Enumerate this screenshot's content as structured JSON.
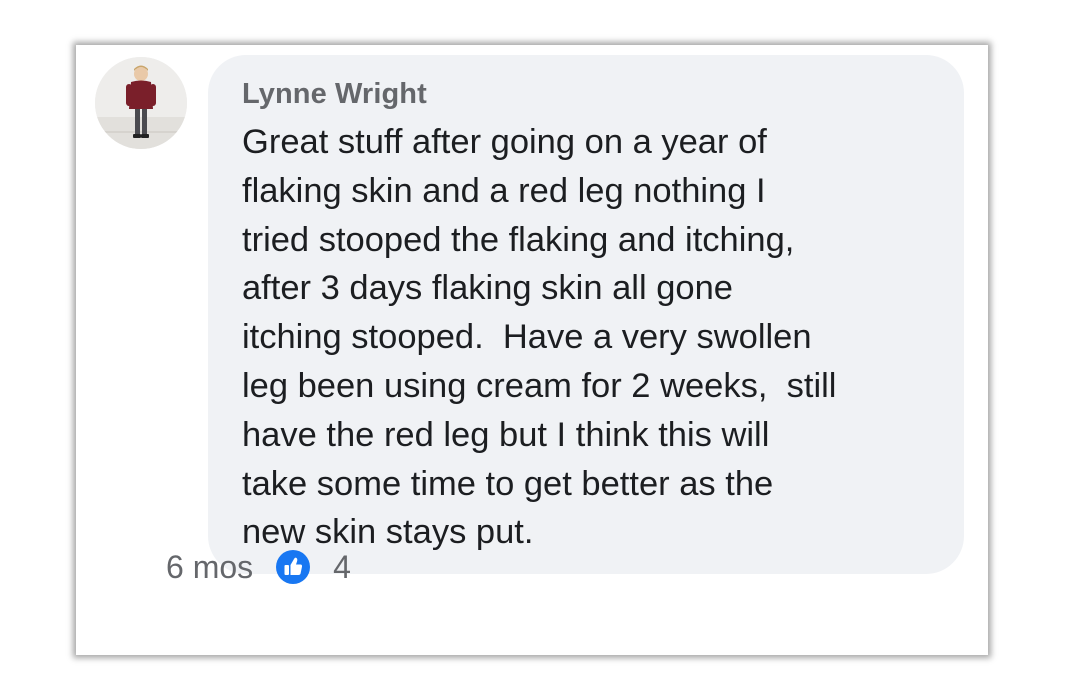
{
  "comment": {
    "author": "Lynne Wright",
    "text": "Great stuff after going on a year of\nflaking skin and a red leg nothing I\ntried stooped the flaking and itching,\nafter 3 days flaking skin all gone\nitching stooped.  Have a very swollen\nleg been using cream for 2 weeks,  still\nhave the red leg but I think this will\ntake some time to get better as the\nnew skin stays put.",
    "time": "6 mos",
    "reaction_count": "4",
    "reaction_icon": "like-icon"
  },
  "colors": {
    "bubble": "#f0f2f5",
    "author": "#65676b",
    "text": "#1c1e21",
    "like": "#1877f2"
  }
}
